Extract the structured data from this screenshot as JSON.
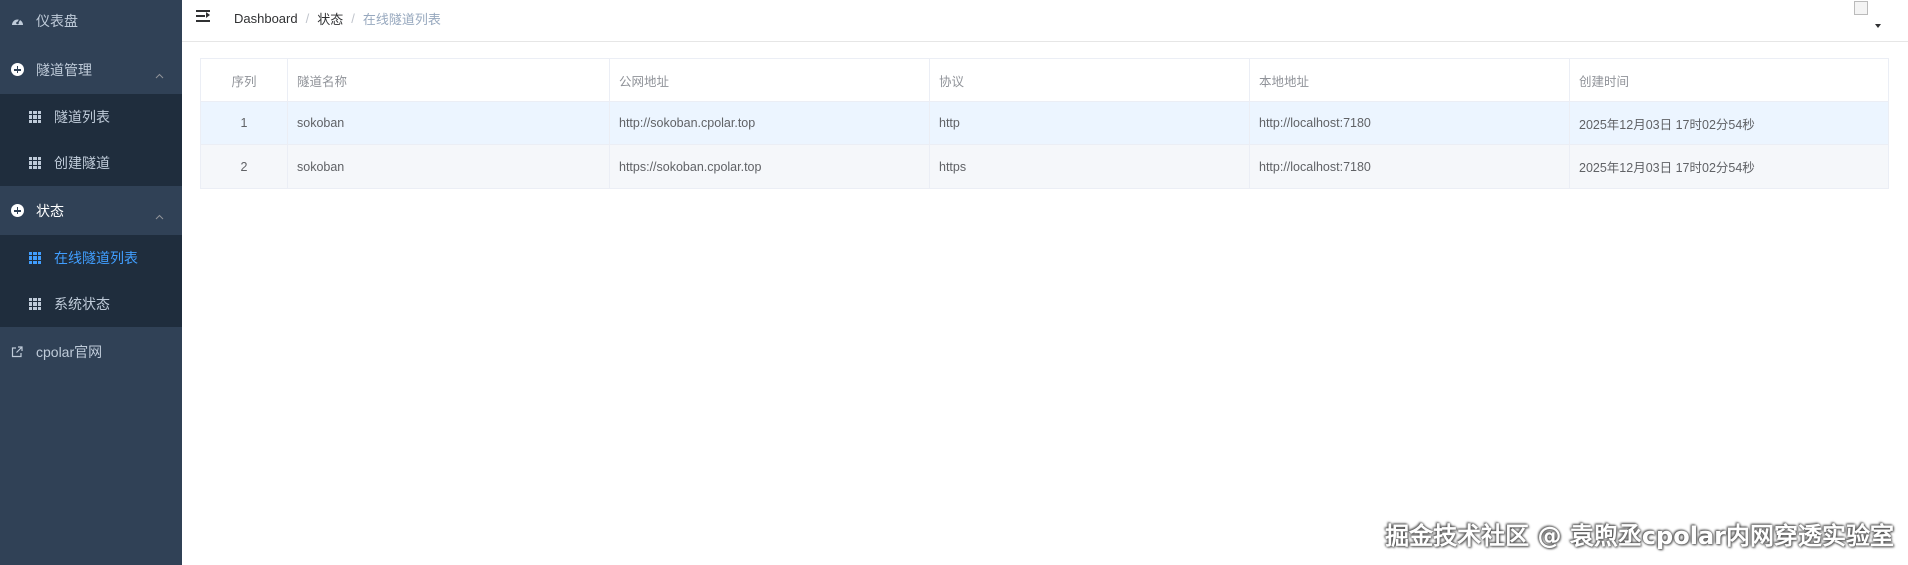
{
  "sidebar": {
    "items": [
      {
        "label": "仪表盘",
        "icon": "dashboard-icon"
      },
      {
        "label": "隧道管理",
        "icon": "plus-circle-icon"
      },
      {
        "label": "隧道列表",
        "icon": "grid-icon"
      },
      {
        "label": "创建隧道",
        "icon": "grid-icon"
      },
      {
        "label": "状态",
        "icon": "plus-circle-icon"
      },
      {
        "label": "在线隧道列表",
        "icon": "grid-icon"
      },
      {
        "label": "系统状态",
        "icon": "grid-icon"
      },
      {
        "label": "cpolar官网",
        "icon": "external-link-icon"
      }
    ],
    "active_color": "#409eff",
    "bg_color": "#304156"
  },
  "breadcrumb": {
    "items": [
      "Dashboard",
      "状态",
      "在线隧道列表"
    ],
    "separator": "/"
  },
  "table": {
    "columns": [
      "序列",
      "隧道名称",
      "公网地址",
      "协议",
      "本地地址",
      "创建时间"
    ],
    "rows": [
      [
        "1",
        "sokoban",
        "http://sokoban.cpolar.top",
        "http",
        "http://localhost:7180",
        "2025年12月03日 17时02分54秒"
      ],
      [
        "2",
        "sokoban",
        "https://sokoban.cpolar.top",
        "https",
        "http://localhost:7180",
        "2025年12月03日 17时02分54秒"
      ]
    ]
  },
  "watermark": "掘金技术社区 @ 袁煦丞cpolar内网穿透实验室"
}
